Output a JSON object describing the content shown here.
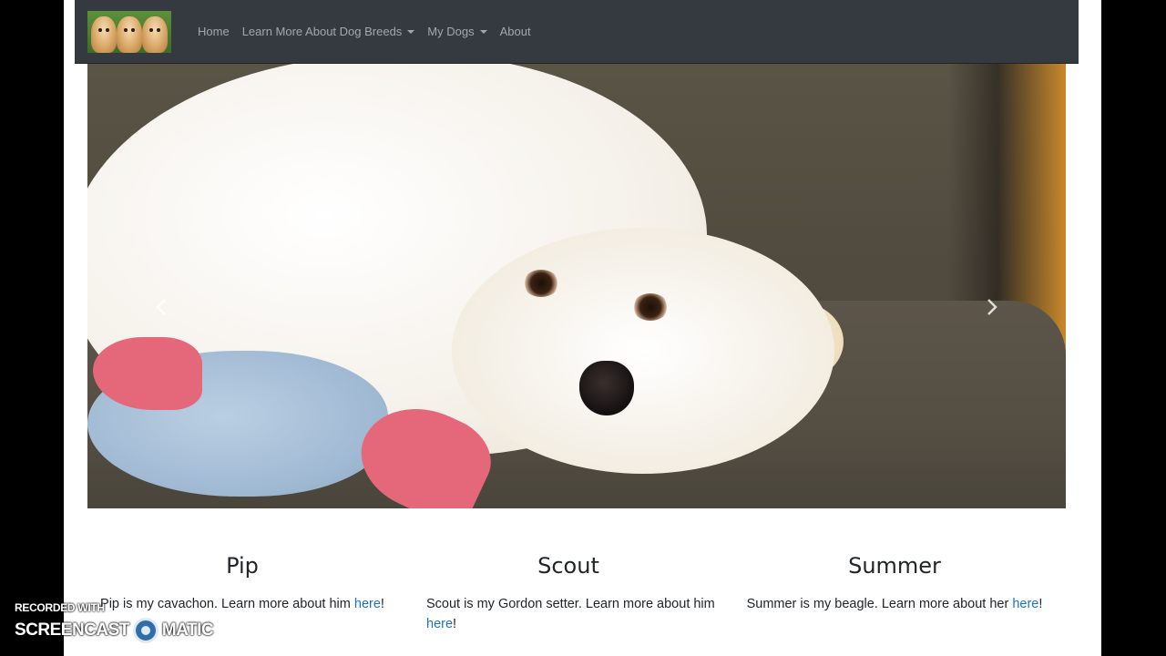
{
  "navbar": {
    "brand_icon": "puppies-logo",
    "links": [
      {
        "label": "Home",
        "dropdown": false
      },
      {
        "label": "Learn More About Dog Breeds",
        "dropdown": true
      },
      {
        "label": "My Dogs",
        "dropdown": true
      },
      {
        "label": "About",
        "dropdown": false
      }
    ]
  },
  "carousel": {
    "prev_icon": "chevron-left-icon",
    "next_icon": "chevron-right-icon"
  },
  "dogs": [
    {
      "name": "Pip",
      "text": "Pip is my cavachon. Learn more about him ",
      "link": "here",
      "suffix": "!"
    },
    {
      "name": "Scout",
      "text": "Scout is my Gordon setter. Learn more about him ",
      "link": "here",
      "suffix": "!"
    },
    {
      "name": "Summer",
      "text": "Summer is my beagle. Learn more about her ",
      "link": "here",
      "suffix": "!"
    }
  ],
  "watermark": {
    "line1": "RECORDED WITH",
    "brand_left": "SCREENCAST",
    "brand_right": "MATIC"
  },
  "colors": {
    "navbar_bg": "#343a40",
    "link": "#1a73c9",
    "text": "#212529"
  }
}
